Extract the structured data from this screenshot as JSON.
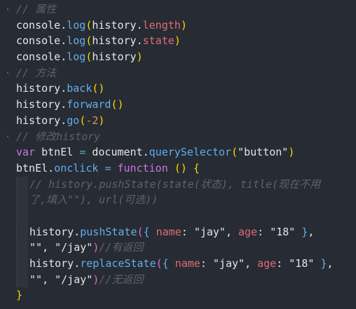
{
  "editor": {
    "lines": [
      {
        "gutter": "·",
        "indent": 0,
        "tokens": [
          {
            "t": "// 属性",
            "c": "c-comment"
          }
        ]
      },
      {
        "gutter": "",
        "indent": 0,
        "tokens": [
          {
            "t": "console.",
            "c": "c-plain"
          },
          {
            "t": "log",
            "c": "c-func"
          },
          {
            "t": "(",
            "c": "c-paren"
          },
          {
            "t": "history.",
            "c": "c-plain"
          },
          {
            "t": "length",
            "c": "c-red"
          },
          {
            "t": ")",
            "c": "c-paren"
          }
        ]
      },
      {
        "gutter": "",
        "indent": 0,
        "tokens": [
          {
            "t": "console.",
            "c": "c-plain"
          },
          {
            "t": "log",
            "c": "c-func"
          },
          {
            "t": "(",
            "c": "c-paren"
          },
          {
            "t": "history.",
            "c": "c-plain"
          },
          {
            "t": "state",
            "c": "c-red"
          },
          {
            "t": ")",
            "c": "c-paren"
          }
        ]
      },
      {
        "gutter": "",
        "indent": 0,
        "tokens": [
          {
            "t": "console.",
            "c": "c-plain"
          },
          {
            "t": "log",
            "c": "c-func"
          },
          {
            "t": "(",
            "c": "c-paren"
          },
          {
            "t": "history",
            "c": "c-plain"
          },
          {
            "t": ")",
            "c": "c-paren"
          }
        ]
      },
      {
        "gutter": "·",
        "indent": 0,
        "tokens": [
          {
            "t": "// 方法",
            "c": "c-comment"
          }
        ]
      },
      {
        "gutter": "",
        "indent": 0,
        "tokens": [
          {
            "t": "history.",
            "c": "c-plain"
          },
          {
            "t": "back",
            "c": "c-func"
          },
          {
            "t": "()",
            "c": "c-paren"
          }
        ]
      },
      {
        "gutter": "",
        "indent": 0,
        "tokens": [
          {
            "t": "history.",
            "c": "c-plain"
          },
          {
            "t": "forward",
            "c": "c-func"
          },
          {
            "t": "()",
            "c": "c-paren"
          }
        ]
      },
      {
        "gutter": "",
        "indent": 0,
        "tokens": [
          {
            "t": "history.",
            "c": "c-plain"
          },
          {
            "t": "go",
            "c": "c-func"
          },
          {
            "t": "(",
            "c": "c-paren"
          },
          {
            "t": "-2",
            "c": "c-number"
          },
          {
            "t": ")",
            "c": "c-paren"
          }
        ]
      },
      {
        "gutter": "·",
        "indent": 0,
        "tokens": [
          {
            "t": "// 修改history",
            "c": "c-comment"
          }
        ]
      },
      {
        "gutter": "",
        "indent": 0,
        "tokens": [
          {
            "t": "var ",
            "c": "c-keyword"
          },
          {
            "t": "btnEl ",
            "c": "c-plain"
          },
          {
            "t": "= ",
            "c": "c-op"
          },
          {
            "t": "document.",
            "c": "c-plain"
          },
          {
            "t": "querySelector",
            "c": "c-func"
          },
          {
            "t": "(",
            "c": "c-paren"
          },
          {
            "t": "\"button\"",
            "c": "c-string"
          },
          {
            "t": ")",
            "c": "c-paren"
          }
        ]
      },
      {
        "gutter": "",
        "indent": 0,
        "tokens": [
          {
            "t": "btnEl.",
            "c": "c-plain"
          },
          {
            "t": "onclick ",
            "c": "c-func"
          },
          {
            "t": "= ",
            "c": "c-op"
          },
          {
            "t": "function ",
            "c": "c-keyword"
          },
          {
            "t": "() ",
            "c": "c-paren"
          },
          {
            "t": "{",
            "c": "c-paren"
          }
        ]
      },
      {
        "gutter": "",
        "indent": 1,
        "tokens": [
          {
            "t": "// history.pushState(state(状态), title(现在不用",
            "c": "c-comment"
          }
        ]
      },
      {
        "gutter": "",
        "indent": 1,
        "tokens": [
          {
            "t": "了,填入\"\"), url(可选))",
            "c": "c-comment"
          }
        ]
      },
      {
        "gutter": "",
        "indent": 1,
        "tokens": []
      },
      {
        "gutter": "",
        "indent": 1,
        "tokens": [
          {
            "t": "history.",
            "c": "c-plain"
          },
          {
            "t": "pushState",
            "c": "c-func"
          },
          {
            "t": "(",
            "c": "c-paren2"
          },
          {
            "t": "{ ",
            "c": "c-prop"
          },
          {
            "t": "name",
            "c": "c-red"
          },
          {
            "t": ": ",
            "c": "c-plain"
          },
          {
            "t": "\"jay\"",
            "c": "c-string"
          },
          {
            "t": ", ",
            "c": "c-plain"
          },
          {
            "t": "age",
            "c": "c-red"
          },
          {
            "t": ": ",
            "c": "c-plain"
          },
          {
            "t": "\"18\" ",
            "c": "c-string"
          },
          {
            "t": "}",
            "c": "c-prop"
          },
          {
            "t": ",",
            "c": "c-plain"
          }
        ]
      },
      {
        "gutter": "",
        "indent": 1,
        "tokens": [
          {
            "t": "\"\"",
            "c": "c-string"
          },
          {
            "t": ", ",
            "c": "c-plain"
          },
          {
            "t": "\"/jay\"",
            "c": "c-string"
          },
          {
            "t": ")",
            "c": "c-paren2"
          },
          {
            "t": "//有返回",
            "c": "c-comment"
          }
        ]
      },
      {
        "gutter": "",
        "indent": 1,
        "tokens": [
          {
            "t": "history.",
            "c": "c-plain"
          },
          {
            "t": "replaceState",
            "c": "c-func"
          },
          {
            "t": "(",
            "c": "c-paren2"
          },
          {
            "t": "{ ",
            "c": "c-prop"
          },
          {
            "t": "name",
            "c": "c-red"
          },
          {
            "t": ": ",
            "c": "c-plain"
          },
          {
            "t": "\"jay\"",
            "c": "c-string"
          },
          {
            "t": ", ",
            "c": "c-plain"
          },
          {
            "t": "age",
            "c": "c-red"
          },
          {
            "t": ": ",
            "c": "c-plain"
          },
          {
            "t": "\"18\" ",
            "c": "c-string"
          },
          {
            "t": "}",
            "c": "c-prop"
          },
          {
            "t": ",",
            "c": "c-plain"
          }
        ]
      },
      {
        "gutter": "",
        "indent": 1,
        "tokens": [
          {
            "t": "\"\"",
            "c": "c-string"
          },
          {
            "t": ", ",
            "c": "c-plain"
          },
          {
            "t": "\"/jay\"",
            "c": "c-string"
          },
          {
            "t": ")",
            "c": "c-paren2"
          },
          {
            "t": "//无返回",
            "c": "c-comment"
          }
        ]
      },
      {
        "gutter": "",
        "indent": 0,
        "tokens": [
          {
            "t": "}",
            "c": "c-paren"
          }
        ]
      }
    ]
  }
}
